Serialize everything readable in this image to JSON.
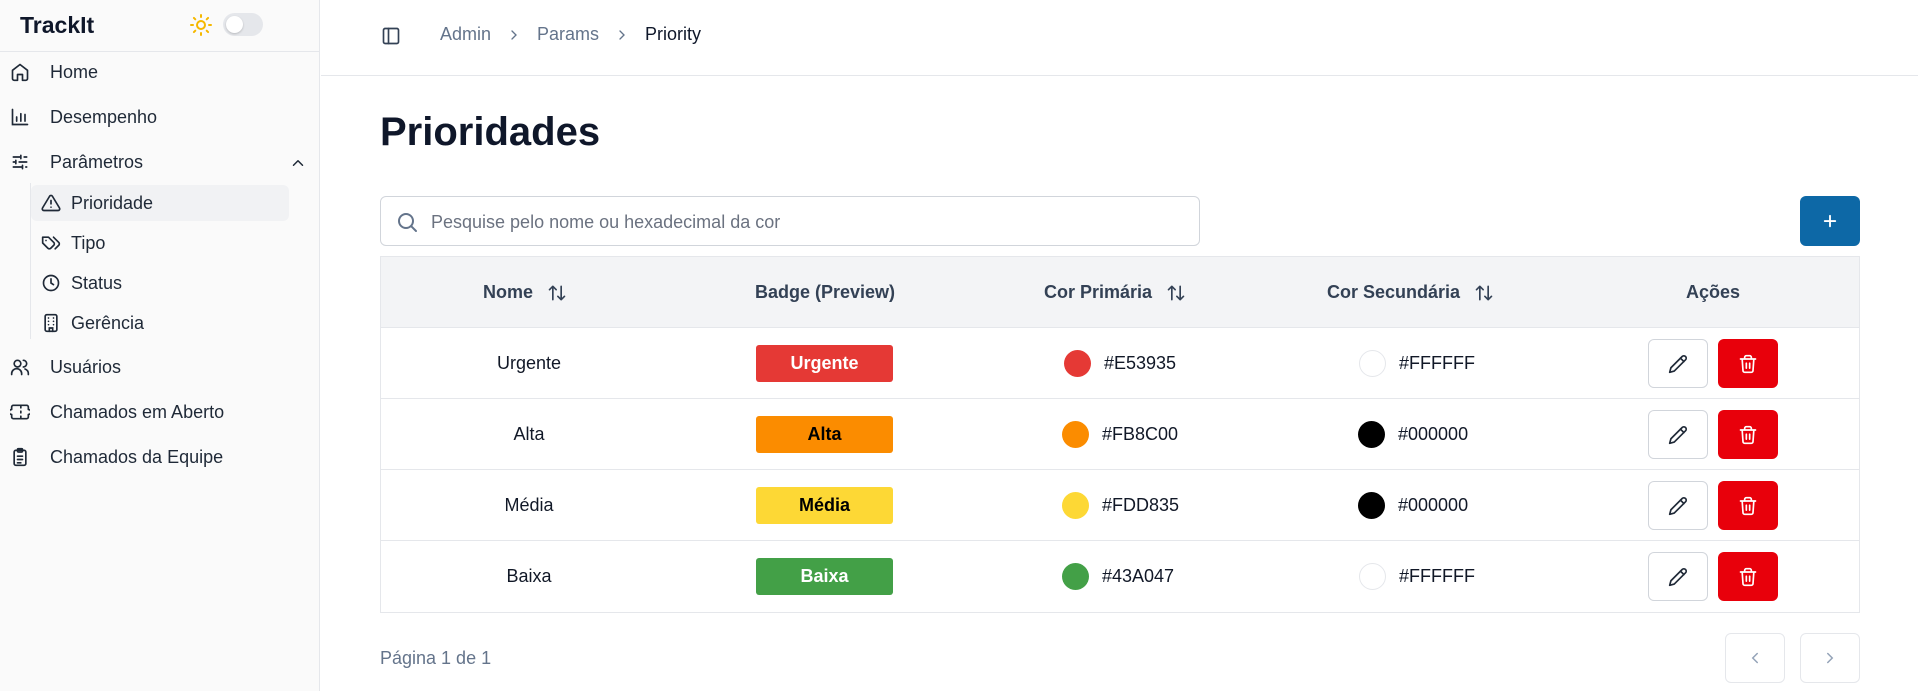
{
  "app": {
    "name": "TrackIt"
  },
  "sidebar": {
    "items": [
      {
        "label": "Home",
        "icon": "home-icon"
      },
      {
        "label": "Desempenho",
        "icon": "bar-chart-icon"
      },
      {
        "label": "Parâmetros",
        "icon": "sliders-icon",
        "expanded": true
      },
      {
        "label": "Usuários",
        "icon": "users-icon"
      },
      {
        "label": "Chamados em Aberto",
        "icon": "ticket-icon"
      },
      {
        "label": "Chamados da Equipe",
        "icon": "clipboard-icon"
      }
    ],
    "sub_items": [
      {
        "label": "Prioridade",
        "icon": "alert-triangle-icon",
        "active": true
      },
      {
        "label": "Tipo",
        "icon": "tags-icon"
      },
      {
        "label": "Status",
        "icon": "clock-icon"
      },
      {
        "label": "Gerência",
        "icon": "building-icon"
      }
    ]
  },
  "breadcrumb": [
    "Admin",
    "Params",
    "Priority"
  ],
  "page": {
    "title": "Prioridades"
  },
  "search": {
    "placeholder": "Pesquise pelo nome ou hexadecimal da cor",
    "value": ""
  },
  "table": {
    "headers": {
      "nome": "Nome",
      "badge": "Badge (Preview)",
      "primary": "Cor Primária",
      "secondary": "Cor Secundária",
      "actions": "Ações"
    },
    "rows": [
      {
        "nome": "Urgente",
        "primary": "#E53935",
        "secondary": "#FFFFFF"
      },
      {
        "nome": "Alta",
        "primary": "#FB8C00",
        "secondary": "#000000"
      },
      {
        "nome": "Média",
        "primary": "#FDD835",
        "secondary": "#000000"
      },
      {
        "nome": "Baixa",
        "primary": "#43A047",
        "secondary": "#FFFFFF"
      }
    ]
  },
  "pagination": {
    "text": "Página 1 de 1"
  },
  "colors": {
    "accent": "#0d68a6",
    "danger": "#e8000b",
    "sun": "#f5b800"
  }
}
